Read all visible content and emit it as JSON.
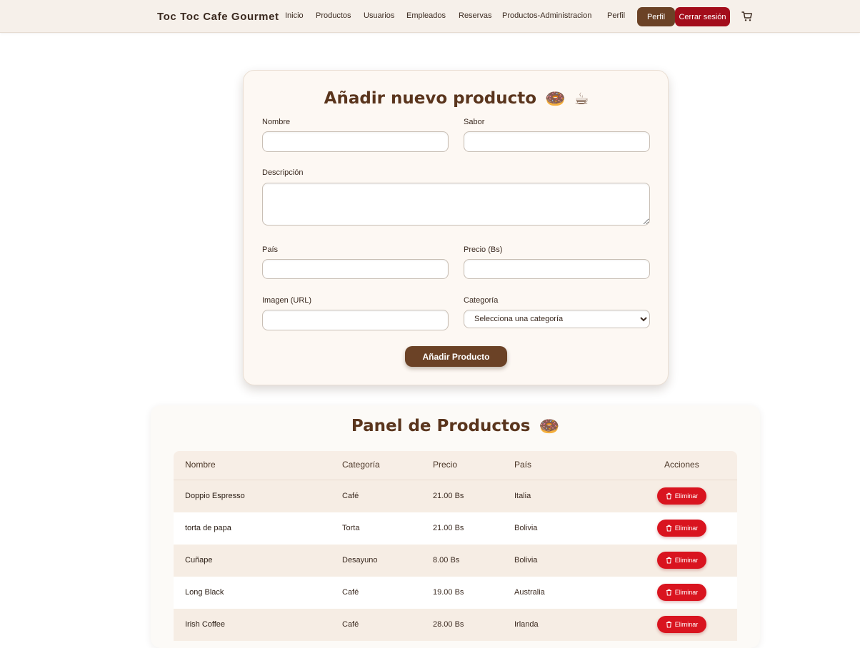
{
  "navbar": {
    "brand": "Toc Toc Cafe Gourmet",
    "links": [
      "Inicio",
      "Productos",
      "Usuarios",
      "Empleados",
      "Reservas",
      "Productos-Administracion",
      "Perfil"
    ],
    "perfil_button": "Perfil",
    "logout_button": "Cerrar sesión",
    "cart_icon": "cart-icon"
  },
  "form": {
    "title": "Añadir nuevo producto",
    "title_emojis": [
      "🍩",
      "☕"
    ],
    "nombre_label": "Nombre",
    "sabor_label": "Sabor",
    "descripcion_label": "Descripción",
    "pais_label": "País",
    "precio_label": "Precio (Bs)",
    "imagen_label": "Imagen (URL)",
    "categoria_label": "Categoría",
    "categoria_selected": "Selecciona una categoría",
    "submit_label": "Añadir Producto"
  },
  "panel": {
    "title": "Panel de Productos",
    "title_emoji": "🍩",
    "columns": [
      "Nombre",
      "Categoría",
      "Precio",
      "País",
      "Acciones"
    ],
    "delete_label": "Eliminar",
    "rows": [
      {
        "nombre": "Doppio Espresso",
        "categoria": "Café",
        "precio": "21.00 Bs",
        "pais": "Italia"
      },
      {
        "nombre": "torta de papa",
        "categoria": "Torta",
        "precio": "21.00 Bs",
        "pais": "Bolivia"
      },
      {
        "nombre": "Cuñape",
        "categoria": "Desayuno",
        "precio": "8.00 Bs",
        "pais": "Bolivia"
      },
      {
        "nombre": "Long Black",
        "categoria": "Café",
        "precio": "19.00 Bs",
        "pais": "Australia"
      },
      {
        "nombre": "Irish Coffee",
        "categoria": "Café",
        "precio": "28.00 Bs",
        "pais": "Irlanda"
      }
    ]
  },
  "colors": {
    "brown": "#6b4226",
    "title_brown": "#5a351d",
    "logout_red": "#a30d1b",
    "delete_red": "#d9141f",
    "nav_bg": "#f6f0ea"
  }
}
